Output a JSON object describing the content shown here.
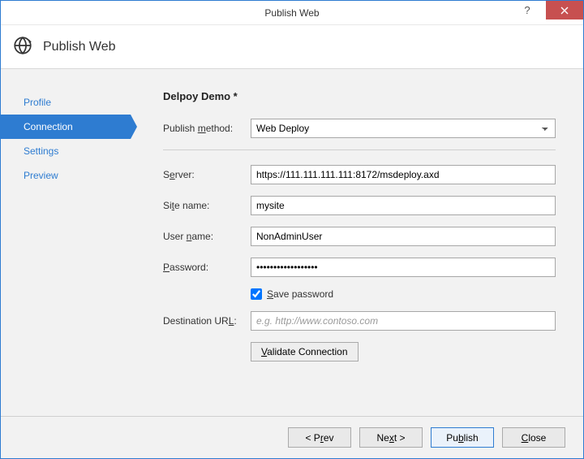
{
  "window": {
    "title": "Publish Web"
  },
  "header": {
    "title": "Publish Web"
  },
  "sidebar": {
    "items": [
      {
        "label": "Profile",
        "active": false
      },
      {
        "label": "Connection",
        "active": true
      },
      {
        "label": "Settings",
        "active": false
      },
      {
        "label": "Preview",
        "active": false
      }
    ]
  },
  "main": {
    "title": "Delpoy Demo *",
    "publish_method": {
      "label": "Publish method:",
      "value": "Web Deploy"
    },
    "server": {
      "label": "Server:",
      "value": "https://111.111.111.111:8172/msdeploy.axd"
    },
    "site_name": {
      "label": "Site name:",
      "value": "mysite"
    },
    "user_name": {
      "label": "User name:",
      "value": "NonAdminUser"
    },
    "password": {
      "label": "Password:",
      "value": "••••••••••••••••••"
    },
    "save_password": {
      "label": "Save password",
      "checked": true
    },
    "destination_url": {
      "label": "Destination URL:",
      "placeholder": "e.g. http://www.contoso.com",
      "value": ""
    },
    "validate_button": "Validate Connection"
  },
  "footer": {
    "prev": "< Prev",
    "next": "Next >",
    "publish": "Publish",
    "close": "Close"
  }
}
